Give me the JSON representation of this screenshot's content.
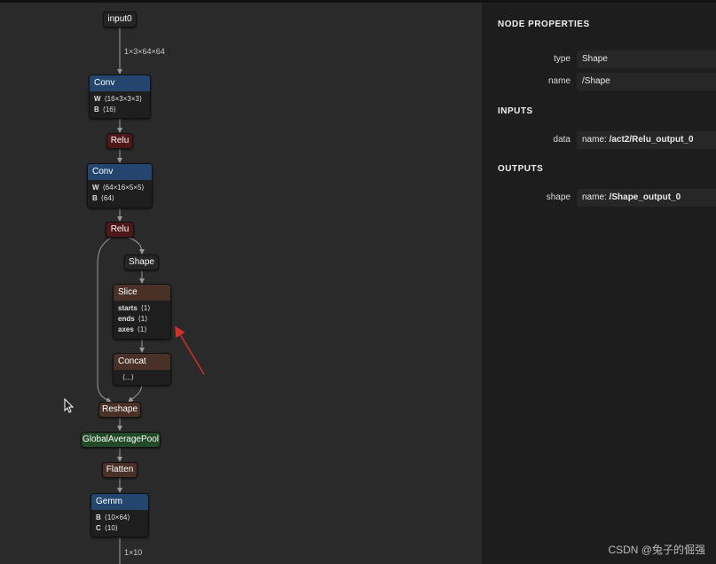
{
  "graph": {
    "input_label": "input0",
    "input_shape": "1×3×64×64",
    "conv1": {
      "title": "Conv",
      "attrs": [
        {
          "k": "W",
          "v": "⟨16×3×3×3⟩"
        },
        {
          "k": "B",
          "v": "⟨16⟩"
        }
      ]
    },
    "relu1": "Relu",
    "conv2": {
      "title": "Conv",
      "attrs": [
        {
          "k": "W",
          "v": "⟨64×16×5×5⟩"
        },
        {
          "k": "B",
          "v": "⟨64⟩"
        }
      ]
    },
    "relu2": "Relu",
    "shape": "Shape",
    "slice": {
      "title": "Slice",
      "attrs": [
        {
          "k": "starts",
          "v": "⟨1⟩"
        },
        {
          "k": "ends",
          "v": "⟨1⟩"
        },
        {
          "k": "axes",
          "v": "⟨1⟩"
        }
      ]
    },
    "concat": {
      "title": "Concat",
      "body": "⟨...⟩"
    },
    "reshape": "Reshape",
    "gap": "GlobalAveragePool",
    "flatten": "Flatten",
    "gemm": {
      "title": "Gemm",
      "attrs": [
        {
          "k": "B",
          "v": "⟨10×64⟩"
        },
        {
          "k": "C",
          "v": "⟨10⟩"
        }
      ]
    },
    "output_shape": "1×10"
  },
  "panel": {
    "title": "NODE PROPERTIES",
    "props": [
      {
        "key": "type",
        "value": "Shape"
      },
      {
        "key": "name",
        "value": "/Shape"
      }
    ],
    "inputs_title": "INPUTS",
    "input": {
      "key": "data",
      "prefix": "name: ",
      "value": "/act2/Relu_output_0"
    },
    "outputs_title": "OUTPUTS",
    "output": {
      "key": "shape",
      "prefix": "name: ",
      "value": "/Shape_output_0"
    }
  },
  "watermark": "CSDN @兔子的倔强",
  "colors": {
    "conv": "#24466e",
    "relu": "#4f1818",
    "slice": "#4a3128",
    "gap": "#234a26",
    "panel": "#1d1d1d",
    "arrow": "#d0302a"
  },
  "icons": [
    "cursor-icon",
    "red-arrow-annotation"
  ]
}
